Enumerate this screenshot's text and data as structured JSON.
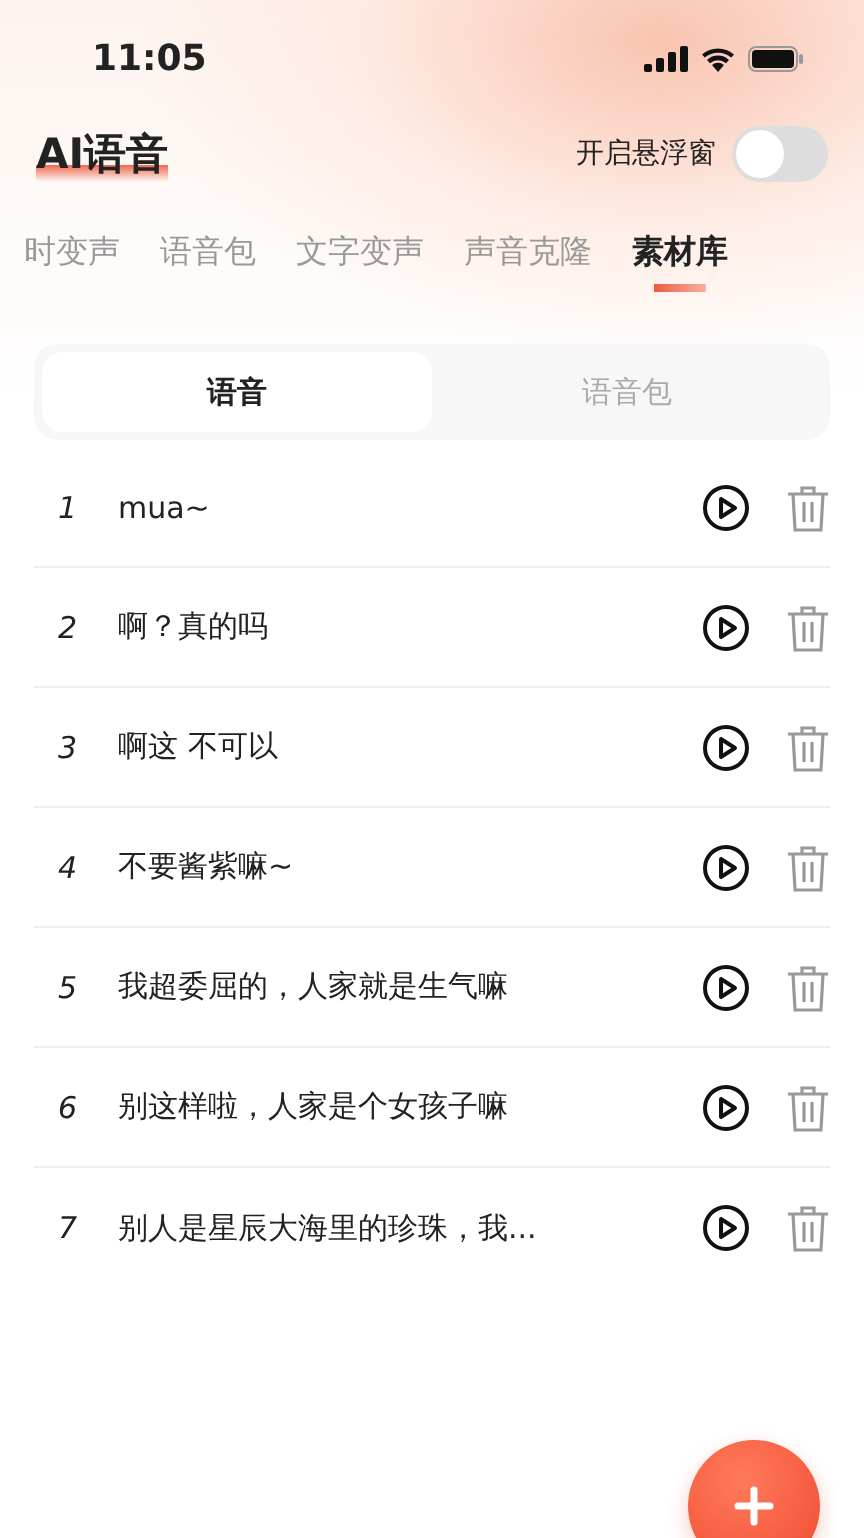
{
  "status_bar": {
    "time": "11:05"
  },
  "header": {
    "title": "AI语音",
    "float_window": {
      "label": "开启悬浮窗",
      "on": false
    }
  },
  "tabs": [
    {
      "label": "时变声",
      "selected": false
    },
    {
      "label": "语音包",
      "selected": false
    },
    {
      "label": "文字变声",
      "selected": false
    },
    {
      "label": "声音克隆",
      "selected": false
    },
    {
      "label": "素材库",
      "selected": true
    }
  ],
  "segments": [
    {
      "label": "语音",
      "selected": true
    },
    {
      "label": "语音包",
      "selected": false
    }
  ],
  "items": [
    {
      "index": "1",
      "text": "mua~"
    },
    {
      "index": "2",
      "text": "啊？真的吗"
    },
    {
      "index": "3",
      "text": "啊这 不可以"
    },
    {
      "index": "4",
      "text": "不要酱紫嘛~"
    },
    {
      "index": "5",
      "text": "我超委屈的，人家就是生气嘛"
    },
    {
      "index": "6",
      "text": "别这样啦，人家是个女孩子嘛"
    },
    {
      "index": "7",
      "text": "别人是星辰大海里的珍珠，我..."
    }
  ]
}
